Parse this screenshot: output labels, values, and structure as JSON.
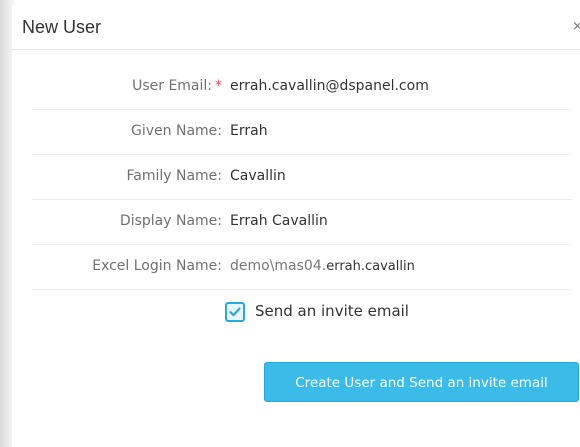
{
  "dialog": {
    "title": "New User",
    "close_label": "×"
  },
  "form": {
    "email": {
      "label": "User Email:",
      "required_mark": "*",
      "value": "errah.cavallin@dspanel.com"
    },
    "given_name": {
      "label": "Given Name:",
      "value": "Errah"
    },
    "family_name": {
      "label": "Family Name:",
      "value": "Cavallin"
    },
    "display_name": {
      "label": "Display Name:",
      "value": "Errah Cavallin"
    },
    "excel_login": {
      "label": "Excel Login Name:",
      "prefix": "demo\\mas04.",
      "suffix": "errah.cavallin"
    },
    "send_invite": {
      "label": "Send an invite email",
      "checked": true
    }
  },
  "actions": {
    "create_label": "Create User and Send an invite email"
  },
  "colors": {
    "accent": "#3bbbe8",
    "required": "#d9534f"
  }
}
